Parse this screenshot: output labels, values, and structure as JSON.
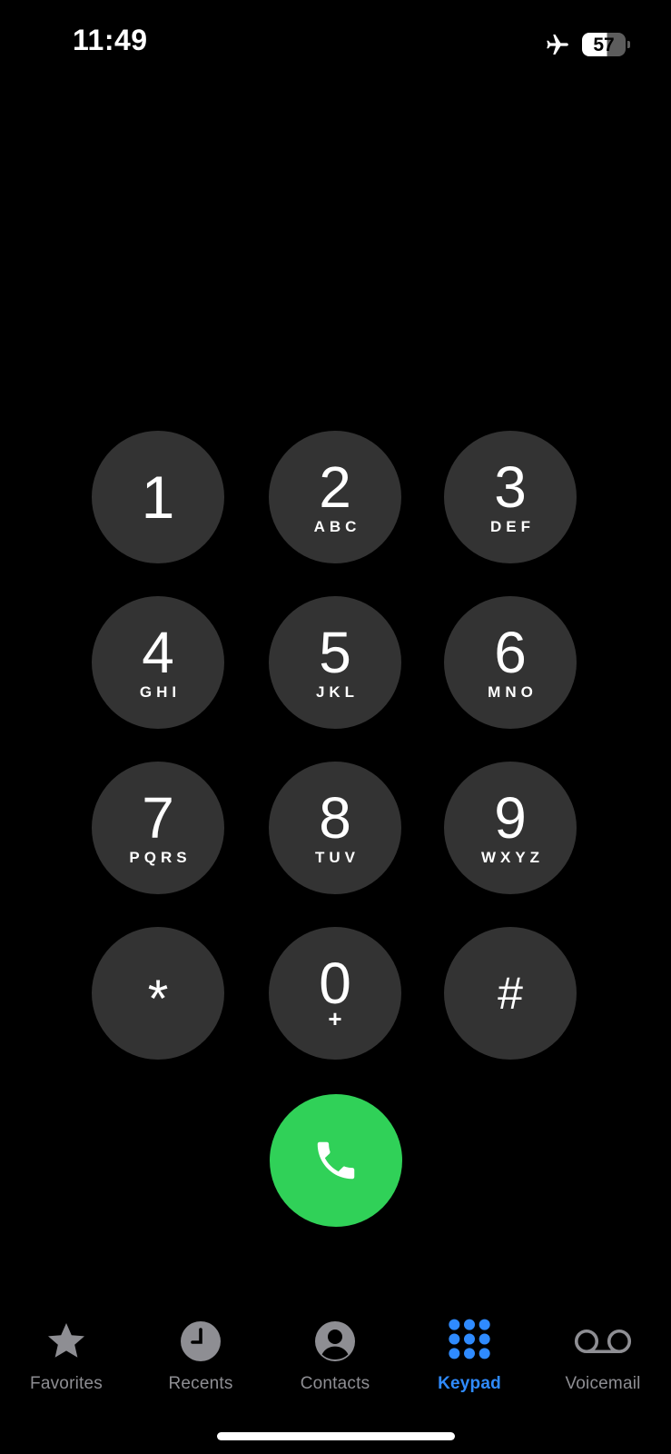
{
  "status_bar": {
    "time": "11:49",
    "battery_level": "57",
    "icons": [
      "airplane-icon",
      "battery-icon"
    ]
  },
  "keypad": {
    "keys": [
      {
        "digit": "1",
        "letters": ""
      },
      {
        "digit": "2",
        "letters": "ABC"
      },
      {
        "digit": "3",
        "letters": "DEF"
      },
      {
        "digit": "4",
        "letters": "GHI"
      },
      {
        "digit": "5",
        "letters": "JKL"
      },
      {
        "digit": "6",
        "letters": "MNO"
      },
      {
        "digit": "7",
        "letters": "PQRS"
      },
      {
        "digit": "8",
        "letters": "TUV"
      },
      {
        "digit": "9",
        "letters": "WXYZ"
      },
      {
        "digit": "*",
        "letters": ""
      },
      {
        "digit": "0",
        "letters": "+"
      },
      {
        "digit": "#",
        "letters": ""
      }
    ]
  },
  "call_button": {
    "icon": "phone-icon",
    "color": "#30d158"
  },
  "tab_bar": {
    "active_color": "#2f8bff",
    "inactive_color": "#8e8e93",
    "tabs": [
      {
        "label": "Favorites",
        "icon": "star-icon"
      },
      {
        "label": "Recents",
        "icon": "clock-icon"
      },
      {
        "label": "Contacts",
        "icon": "person-icon"
      },
      {
        "label": "Keypad",
        "icon": "keypad-grid-icon",
        "active": true
      },
      {
        "label": "Voicemail",
        "icon": "voicemail-icon"
      }
    ]
  }
}
